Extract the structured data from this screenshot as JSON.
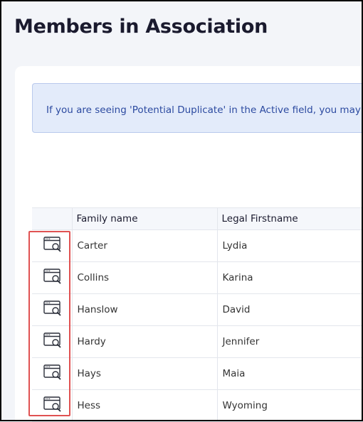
{
  "page": {
    "title": "Members in Association"
  },
  "notice": {
    "text": "If you are seeing 'Potential Duplicate' in the Active field, you may"
  },
  "table": {
    "columns": [
      "",
      "Family name",
      "Legal Firstname"
    ],
    "rows": [
      {
        "action_icon": "browser-search-icon",
        "family_name": "Carter",
        "legal_firstname": "Lydia"
      },
      {
        "action_icon": "browser-search-icon",
        "family_name": "Collins",
        "legal_firstname": "Karina"
      },
      {
        "action_icon": "browser-search-icon",
        "family_name": "Hanslow",
        "legal_firstname": "David"
      },
      {
        "action_icon": "browser-search-icon",
        "family_name": "Hardy",
        "legal_firstname": "Jennifer"
      },
      {
        "action_icon": "browser-search-icon",
        "family_name": "Hays",
        "legal_firstname": "Maia"
      },
      {
        "action_icon": "browser-search-icon",
        "family_name": "Hess",
        "legal_firstname": "Wyoming"
      }
    ]
  },
  "colors": {
    "notice_text": "#2c4aa0",
    "notice_bg": "#e3ebfa",
    "highlight": "#e05252"
  }
}
